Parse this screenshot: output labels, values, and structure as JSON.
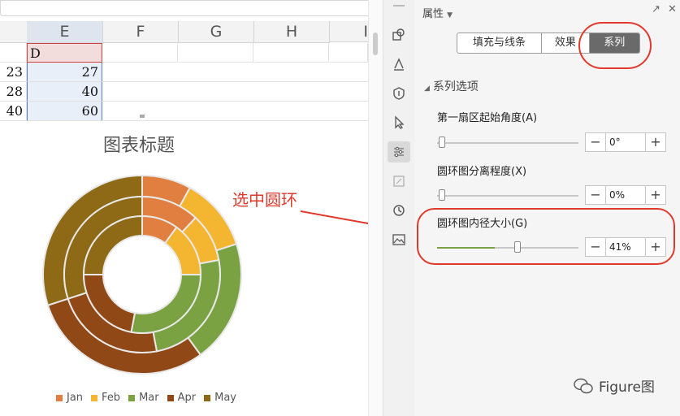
{
  "sheet": {
    "columns": [
      "E",
      "F",
      "G",
      "H",
      "I"
    ],
    "selected_header": "D",
    "rows": [
      {
        "d": "23",
        "e": "27"
      },
      {
        "d": "28",
        "e": "40"
      },
      {
        "d": "40",
        "e": "60"
      }
    ]
  },
  "chart": {
    "title": "图表标题",
    "annotation": "选中圆环"
  },
  "chart_data": {
    "type": "doughnut",
    "title": "图表标题",
    "categories": [
      "Jan",
      "Feb",
      "Mar",
      "Apr",
      "May"
    ],
    "colors": [
      "#e07f3f",
      "#f4b530",
      "#7aa243",
      "#8f4816",
      "#8e6a17"
    ],
    "series": [
      {
        "values": [
          8,
          12,
          20,
          30,
          30
        ]
      },
      {
        "values": [
          12,
          10,
          25,
          23,
          30
        ]
      },
      {
        "values": [
          10,
          15,
          28,
          22,
          25
        ]
      }
    ]
  },
  "panel": {
    "title": "属性",
    "tabs": [
      "填充与线条",
      "效果",
      "系列"
    ],
    "active_tab": "系列",
    "section": "系列选项",
    "fields": [
      {
        "label": "第一扇区起始角度(A)",
        "value": "0°",
        "level": 0
      },
      {
        "label": "圆环图分离程度(X)",
        "value": "0%",
        "level": 0
      },
      {
        "label": "圆环图内径大小(G)",
        "value": "41%",
        "level": 0.41
      }
    ],
    "minus": "−",
    "plus": "+"
  },
  "watermark": "Figure图"
}
